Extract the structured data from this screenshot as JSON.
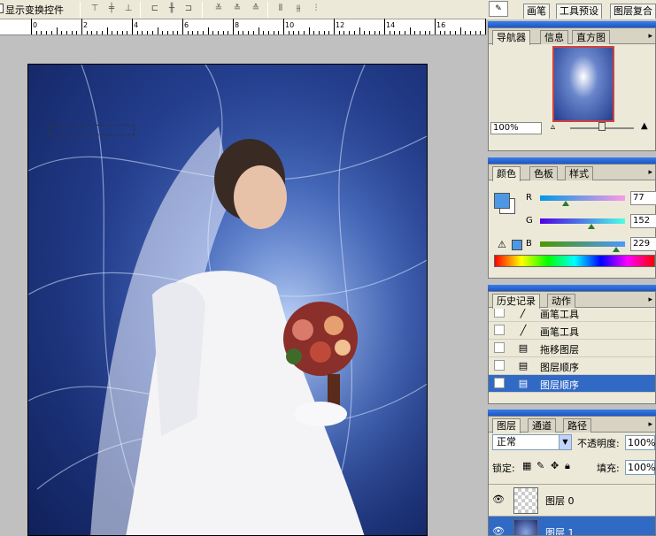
{
  "options_bar": {
    "show_transform_controls_label": "显示变换控件",
    "align_icons": [
      "align-top-icon",
      "align-vcenter-icon",
      "align-bottom-icon",
      "align-left-icon",
      "align-hcenter-icon",
      "align-right-icon"
    ],
    "distribute_icons": [
      "distribute-top-icon",
      "distribute-vcenter-icon",
      "distribute-bottom-icon",
      "distribute-left-icon",
      "distribute-hcenter-icon",
      "distribute-right-icon"
    ],
    "palette_well_tabs": [
      "画笔",
      "工具预设",
      "图层复合"
    ]
  },
  "ruler": {
    "ticks": [
      "0",
      "2",
      "4",
      "6",
      "8",
      "10",
      "12",
      "14",
      "16"
    ]
  },
  "navigator_panel": {
    "tabs": [
      "导航器",
      "信息",
      "直方图"
    ],
    "zoom_value": "100%"
  },
  "color_panel": {
    "tabs": [
      "颜色",
      "色板",
      "样式"
    ],
    "foreground_color": "#4d98e5",
    "background_color": "#ffffff",
    "channels": [
      {
        "label": "R",
        "value": "77",
        "level": 0.3
      },
      {
        "label": "G",
        "value": "152",
        "level": 0.6
      },
      {
        "label": "B",
        "value": "229",
        "level": 0.9
      }
    ]
  },
  "history_panel": {
    "tabs": [
      "历史记录",
      "动作"
    ],
    "items": [
      {
        "label": "画笔工具",
        "icon": "brush-icon",
        "selected": false
      },
      {
        "label": "画笔工具",
        "icon": "brush-icon",
        "selected": false
      },
      {
        "label": "拖移图层",
        "icon": "history-step-icon",
        "selected": false
      },
      {
        "label": "图层顺序",
        "icon": "history-step-icon",
        "selected": false
      },
      {
        "label": "图层顺序",
        "icon": "history-step-icon",
        "selected": true
      }
    ]
  },
  "layers_panel": {
    "tabs": [
      "图层",
      "通道",
      "路径"
    ],
    "blend_mode": "正常",
    "opacity_label": "不透明度:",
    "opacity_value": "100%",
    "lock_label": "锁定:",
    "fill_label": "填充:",
    "fill_value": "100%",
    "layers": [
      {
        "name": "图层 0",
        "selected": false
      },
      {
        "name": "图层 1",
        "selected": true
      }
    ]
  },
  "colors": {
    "accent_selection": "#316ac5",
    "title_bar": "#1b55c8"
  }
}
